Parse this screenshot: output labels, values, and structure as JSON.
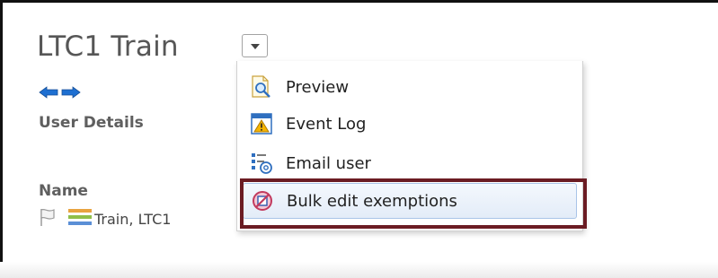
{
  "page": {
    "title": "LTC1 Train",
    "section_label": "User Details",
    "name_label": "Name",
    "name_value": "Train, LTC1"
  },
  "icons": {
    "dropdown": "chevron-down-icon",
    "back": "arrow-left-icon",
    "forward": "arrow-right-icon",
    "flag": "flag-icon",
    "rank": "rank-bars-icon"
  },
  "menu": {
    "items": [
      {
        "label": "Preview",
        "icon": "preview-magnifier-icon"
      },
      {
        "label": "Event Log",
        "icon": "warning-icon"
      },
      {
        "label": "Email user",
        "icon": "email-user-icon"
      },
      {
        "label": "Bulk edit exemptions",
        "icon": "exemption-icon"
      }
    ],
    "hover_index": 3
  },
  "colors": {
    "arrow_blue": "#1e6fd1",
    "highlight_border": "#6b1c23",
    "hover_border": "#a9c4e8",
    "title_text": "#565656"
  }
}
